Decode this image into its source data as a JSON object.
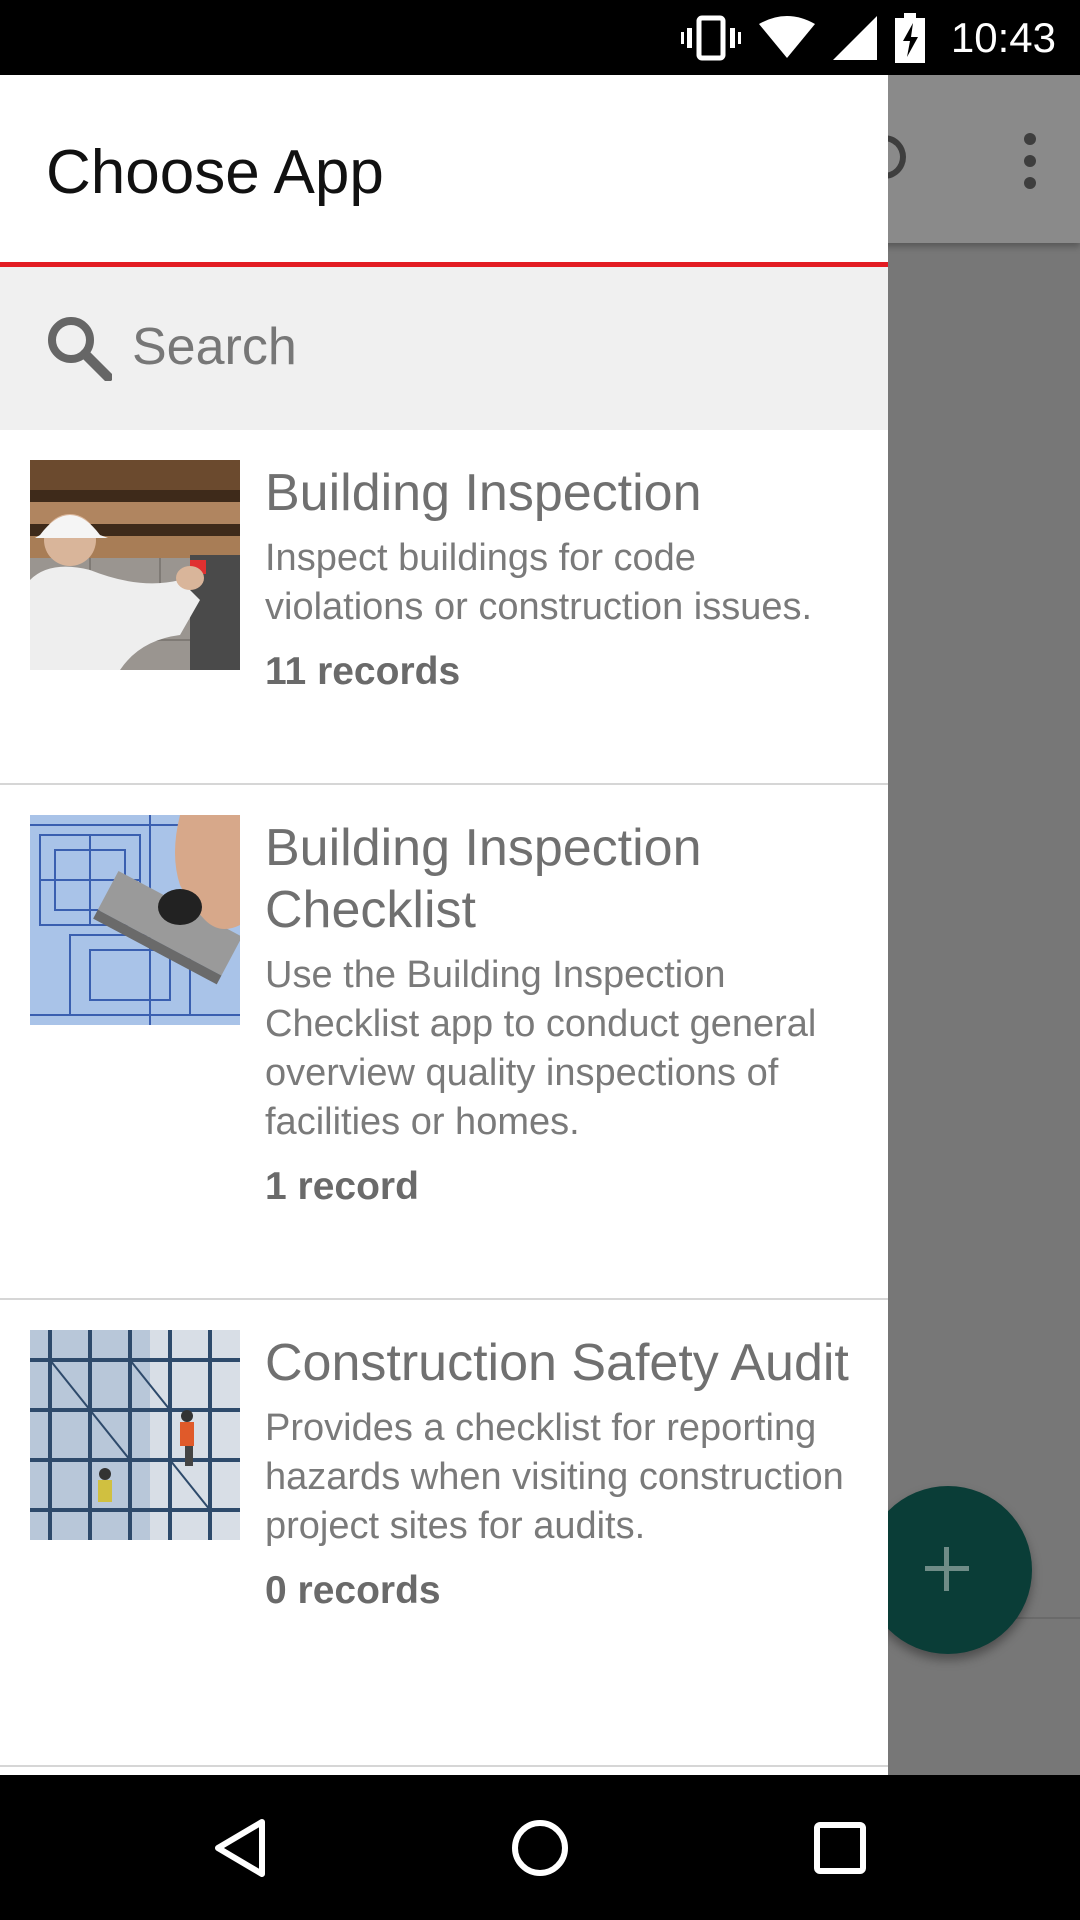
{
  "status_bar": {
    "time": "10:43",
    "icons": [
      "vibrate-icon",
      "wifi-icon",
      "cell-signal-icon",
      "battery-charging-icon"
    ]
  },
  "drawer": {
    "title": "Choose App",
    "accent_color": "#e31c23",
    "search": {
      "placeholder": "Search",
      "icon": "search-icon"
    },
    "apps": [
      {
        "name": "Building Inspection",
        "description": "Inspect buildings for code violations or construction issues.",
        "records": "11 records"
      },
      {
        "name": "Building Inspection Checklist",
        "description": "Use the Building Inspection Checklist app to conduct general overview quality inspections of facilities or homes.",
        "records": "1 record"
      },
      {
        "name": "Construction Safety Audit",
        "description": "Provides a checklist for reporting hazards when visiting construction project sites for audits.",
        "records": "0 records"
      }
    ]
  },
  "background": {
    "fab_icon": "plus-icon",
    "fab_color": "#0a3d37",
    "overflow_icon": "overflow-menu-icon"
  },
  "nav_bar": {
    "buttons": [
      "back-icon",
      "home-icon",
      "recents-icon"
    ]
  }
}
